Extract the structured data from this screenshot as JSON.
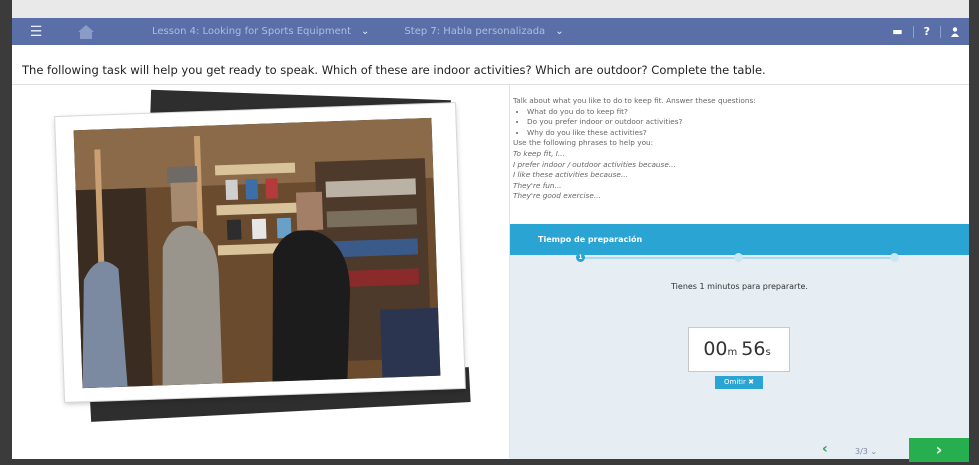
{
  "topbar": {
    "menu_icon": "hamburger-icon",
    "home_icon": "home-icon",
    "lesson_label": "Lesson 4: Looking for Sports Equipment",
    "step_label": "Step 7: Habla personalizada",
    "icons": [
      "chat-icon",
      "help-icon",
      "user-icon"
    ],
    "help_glyph": "?"
  },
  "instruction": "The following task will help you get ready to speak. Which of these are indoor activities? Which are outdoor? Complete the table.",
  "prompt": {
    "intro": "Talk about what you like to do to keep fit. Answer these questions:",
    "questions": [
      "What do you do to keep fit?",
      "Do you prefer indoor or outdoor activities?",
      "Why do you like these activities?"
    ],
    "phrases_intro": "Use the following phrases to help you:",
    "phrases": [
      "To keep fit, I...",
      "I prefer indoor / outdoor activities because...",
      "I like these activities because...",
      "They're fun...",
      "They're good exercise..."
    ]
  },
  "prep": {
    "title": "Tiempo de preparación",
    "step_number": "1",
    "message": "Tienes 1 minutos para prepararte.",
    "minutes": "00",
    "minutes_unit": "m",
    "seconds": "56",
    "seconds_unit": "s",
    "skip_label": "Omitir ✖"
  },
  "navigation": {
    "prev_glyph": "‹",
    "page": "3/3",
    "next_glyph": "›"
  },
  "colors": {
    "topbar": "#5a6fa7",
    "accent": "#2aa4d3",
    "next_button": "#27ae4e"
  }
}
